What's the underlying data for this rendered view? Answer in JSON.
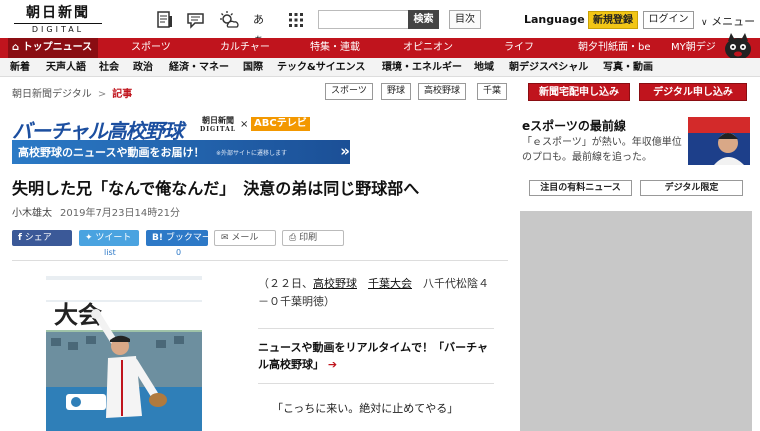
{
  "header": {
    "logo_main": "朝日新聞",
    "logo_sub": "DIGITAL",
    "search_button": "検索",
    "index_button": "目次",
    "language": "Language",
    "register": "新規登録",
    "login": "ログイン",
    "menu": "メニュー",
    "icons": [
      "news-icon",
      "comment-icon",
      "weather-icon",
      "font-size-icon",
      "grid-icon"
    ],
    "font_size_label": "あぁ"
  },
  "nav_main": [
    "トップニュース",
    "スポーツ",
    "カルチャー",
    "特集・連載",
    "オピニオン",
    "ライフ",
    "朝夕刊紙面・be",
    "MY朝デジ"
  ],
  "nav_sub": [
    "新着",
    "天声人語",
    "社会",
    "政治",
    "経済・マネー",
    "国際",
    "テック&サイエンス",
    "環境・エネルギー",
    "地域",
    "朝デジスペシャル",
    "写真・動画"
  ],
  "breadcrumb": {
    "home": "朝日新聞デジタル",
    "sep": ">",
    "current": "記事"
  },
  "tags": [
    "スポーツ",
    "野球",
    "高校野球",
    "千葉"
  ],
  "right_buttons": {
    "paper": "新聞宅配申し込み",
    "digital": "デジタル申し込み"
  },
  "banner": {
    "title": "バーチャル高校野球",
    "partner1_line1": "朝日新聞",
    "partner1_line2": "DIGITAL",
    "times": "×",
    "partner2": "ABCテレビ",
    "bar_text": "高校野球のニュースや動画をお届け！",
    "bar_note": "※外部サイトに遷移します",
    "bar_arrows": "»"
  },
  "article": {
    "headline": "失明した兄「なんで俺なんだ」　決意の弟は同じ野球部へ",
    "author": "小木雄太",
    "date": "2019年7月23日14時21分",
    "share": {
      "facebook": "シェア",
      "twitter": "ツイート",
      "hatena": "ブックマーク",
      "mail": "メール",
      "print": "印刷",
      "twitter_count": "list",
      "hatena_count": "0"
    },
    "caption_prefix": "（２２日、",
    "caption_link1": "高校野球",
    "caption_space": "　",
    "caption_link2": "千葉大会",
    "caption_rest": "　八千代松陰４－０千葉明徳）",
    "promo": "ニュースや動画をリアルタイムで！「バーチャル高校野球」",
    "promo_arrow": "➔",
    "quote": "「こっちに来い。絶対に止めてやる」",
    "photo_banner_text": "大会"
  },
  "sidebar": {
    "title": "eスポーツの最前線",
    "text": "「ｅスポーツ」が熱い。年収億単位のプロも。最前線を追った。",
    "btn_paid": "注目の有料ニュース",
    "btn_digital": "デジタル限定"
  },
  "colors": {
    "brand_red": "#c0141d",
    "banner_blue": "#1c4fa0",
    "register_yellow": "#f2c616"
  }
}
